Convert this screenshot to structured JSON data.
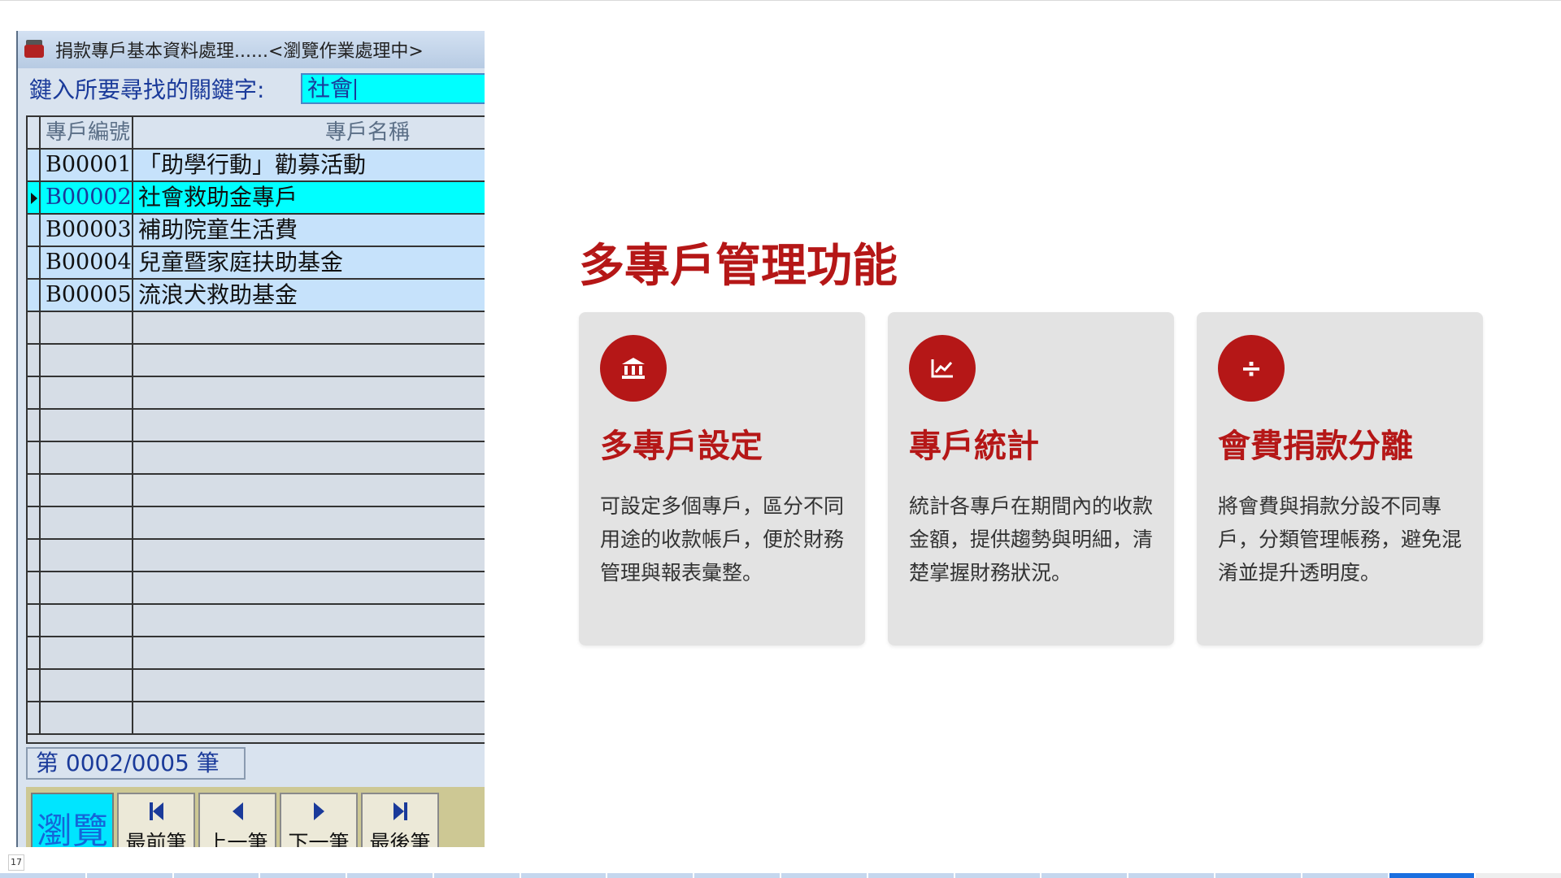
{
  "window": {
    "title": "捐款專戶基本資料處理......<瀏覽作業處理中>",
    "search_label": "鍵入所要尋找的關鍵字:",
    "search_value": "社會"
  },
  "grid": {
    "headers": {
      "code": "專戶編號",
      "name": "專戶名稱"
    },
    "rows": [
      {
        "code": "B00001",
        "name": "「助學行動」勸募活動",
        "selected": false
      },
      {
        "code": "B00002",
        "name": "社會救助金專戶",
        "selected": true
      },
      {
        "code": "B00003",
        "name": "補助院童生活費",
        "selected": false
      },
      {
        "code": "B00004",
        "name": "兒童暨家庭扶助基金",
        "selected": false
      },
      {
        "code": "B00005",
        "name": "流浪犬救助基金",
        "selected": false
      }
    ]
  },
  "record_counter": "第 0002/0005 筆",
  "nav": {
    "mode": "瀏覽",
    "first": "最前筆",
    "prev": "上一筆",
    "next": "下一筆",
    "last": "最後筆"
  },
  "slide": {
    "title": "多專戶管理功能",
    "cards": [
      {
        "icon": "bank-icon",
        "title": "多專戶設定",
        "body": "可設定多個專戶，區分不同用途的收款帳戶，便於財務管理與報表彙整。"
      },
      {
        "icon": "chart-line-icon",
        "title": "專戶統計",
        "body": "統計各專戶在期間內的收款金額，提供趨勢與明細，清楚掌握財務狀況。"
      },
      {
        "icon": "divide-icon",
        "title": "會費捐款分離",
        "body": "將會費與捐款分設不同專戶，分類管理帳務，避免混淆並提升透明度。"
      }
    ]
  },
  "page_number": "17",
  "colors": {
    "accent": "#b51717",
    "card_bg": "#e3e3e3",
    "selected_row": "#00ffff",
    "data_row": "#c6e2fb"
  }
}
